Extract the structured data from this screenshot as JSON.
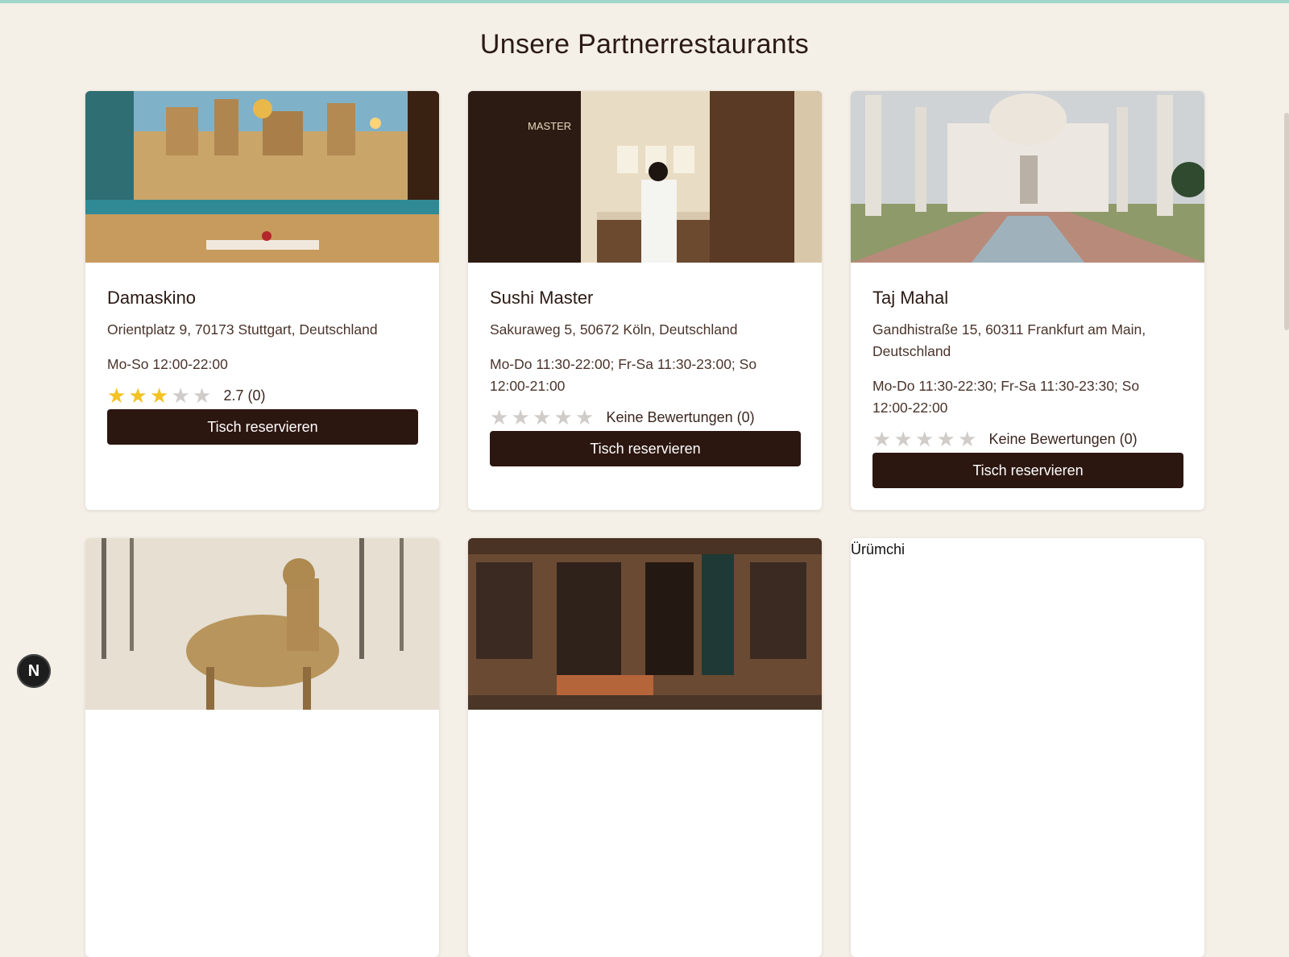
{
  "page": {
    "title": "Unsere Partnerrestaurants"
  },
  "dev_badge": {
    "letter": "N"
  },
  "restaurants": [
    {
      "name": "Damaskino",
      "address": "Orientplatz 9, 70173 Stuttgart, Deutschland",
      "hours": "Mo-So 12:00-22:00",
      "rating_value": 2.7,
      "rating_text": "2.7 (0)",
      "button_label": "Tisch reservieren",
      "image_subject": "arabic-restaurant-interior"
    },
    {
      "name": "Sushi Master",
      "address": "Sakuraweg 5, 50672 Köln, Deutschland",
      "hours": "Mo-Do 11:30-22:00; Fr-Sa 11:30-23:00; So 12:00-21:00",
      "rating_value": 0,
      "rating_text": "Keine Bewertungen (0)",
      "button_label": "Tisch reservieren",
      "image_subject": "sushi-chef-restaurant",
      "image_sign": "MASTER"
    },
    {
      "name": "Taj Mahal",
      "address": "Gandhistraße 15, 60311 Frankfurt am Main, Deutschland",
      "hours": "Mo-Do 11:30-22:30; Fr-Sa 11:30-23:30; So 12:00-22:00",
      "rating_value": 0,
      "rating_text": "Keine Bewertungen (0)",
      "button_label": "Tisch reservieren",
      "image_subject": "taj-mahal-monument"
    },
    {
      "image_subject": "deer-illustration"
    },
    {
      "image_subject": "cafe-storefront"
    },
    {
      "image_alt": "Ürümchi"
    }
  ],
  "colors": {
    "background": "#f4efe7",
    "button": "#2c1610",
    "star_on": "#f2c323",
    "star_off": "#d0ccc9",
    "accent_bar": "#9fd6c9"
  }
}
